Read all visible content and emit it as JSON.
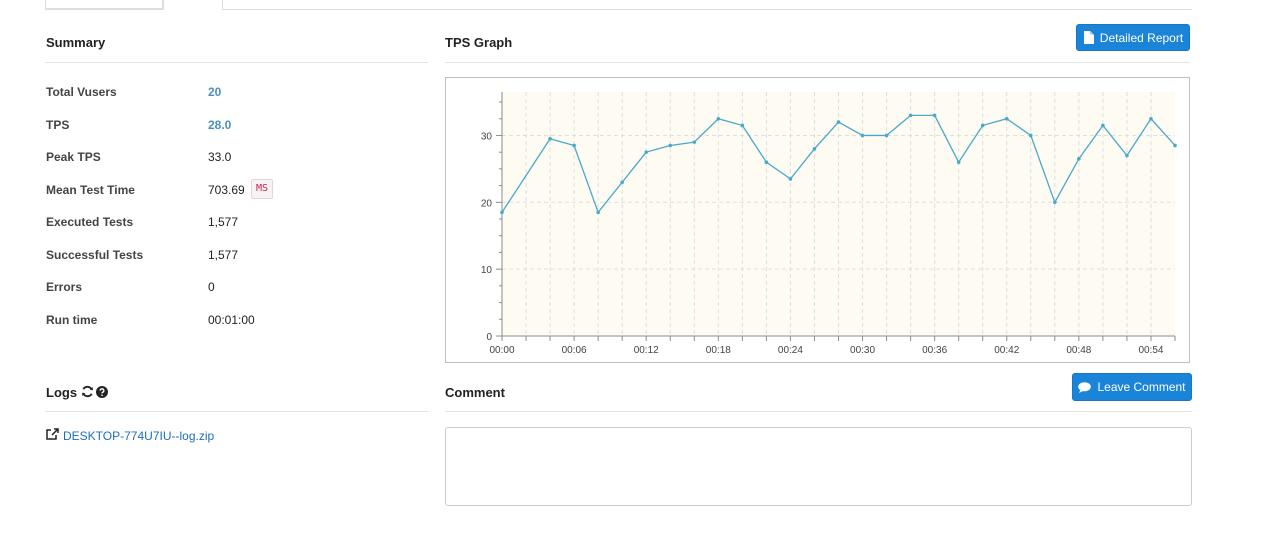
{
  "summary": {
    "title": "Summary",
    "rows": [
      {
        "label": "Total Vusers",
        "value": "20"
      },
      {
        "label": "TPS",
        "value": "28.0"
      },
      {
        "label": "Peak TPS",
        "value": "33.0"
      },
      {
        "label": "Mean Test Time",
        "value": "703.69",
        "unit": "MS"
      },
      {
        "label": "Executed Tests",
        "value": "1,577"
      },
      {
        "label": "Successful Tests",
        "value": "1,577"
      },
      {
        "label": "Errors",
        "value": "0"
      },
      {
        "label": "Run time",
        "value": "00:01:00"
      }
    ]
  },
  "tps_graph": {
    "title": "TPS Graph",
    "detailed_report_label": "Detailed Report"
  },
  "logs": {
    "title": "Logs",
    "file_link": "DESKTOP-774U7IU--log.zip"
  },
  "comment": {
    "title": "Comment",
    "leave_comment_label": "Leave Comment",
    "text": ""
  },
  "colors": {
    "accent": "#1a84d8",
    "link_value": "#4a8fc3",
    "chart_line": "#4aa8c8",
    "plot_bg": "#fdfbf2"
  },
  "icons": {
    "detailed_report": "file-icon",
    "leave_comment": "comment-icon",
    "logs_refresh": "refresh-icon",
    "logs_help": "question-circle-icon",
    "log_link": "external-link-icon"
  },
  "chart_data": {
    "type": "line",
    "title": "",
    "xlabel": "",
    "ylabel": "",
    "x_ticks": [
      "00:00",
      "00:06",
      "00:12",
      "00:18",
      "00:24",
      "00:30",
      "00:36",
      "00:42",
      "00:48",
      "00:54"
    ],
    "y_ticks": [
      "0",
      "10",
      "20",
      "30"
    ],
    "ylim": [
      0,
      36.5
    ],
    "xlim_seconds": [
      0,
      56
    ],
    "grid": true,
    "legend": "none",
    "series": [
      {
        "name": "",
        "x_seconds": [
          0,
          4,
          6,
          8,
          10,
          12,
          14,
          16,
          18,
          20,
          22,
          24,
          26,
          28,
          30,
          32,
          34,
          36,
          38,
          40,
          42,
          44,
          46,
          48,
          50,
          52,
          54,
          56
        ],
        "values": [
          18.5,
          29.5,
          28.5,
          18.5,
          23,
          27.5,
          28.5,
          29,
          32.5,
          31.5,
          26,
          23.5,
          28,
          32,
          30,
          30,
          33,
          33,
          26,
          31.5,
          32.5,
          30,
          20,
          26.5,
          31.5,
          27,
          32.5,
          28.5
        ]
      }
    ]
  }
}
